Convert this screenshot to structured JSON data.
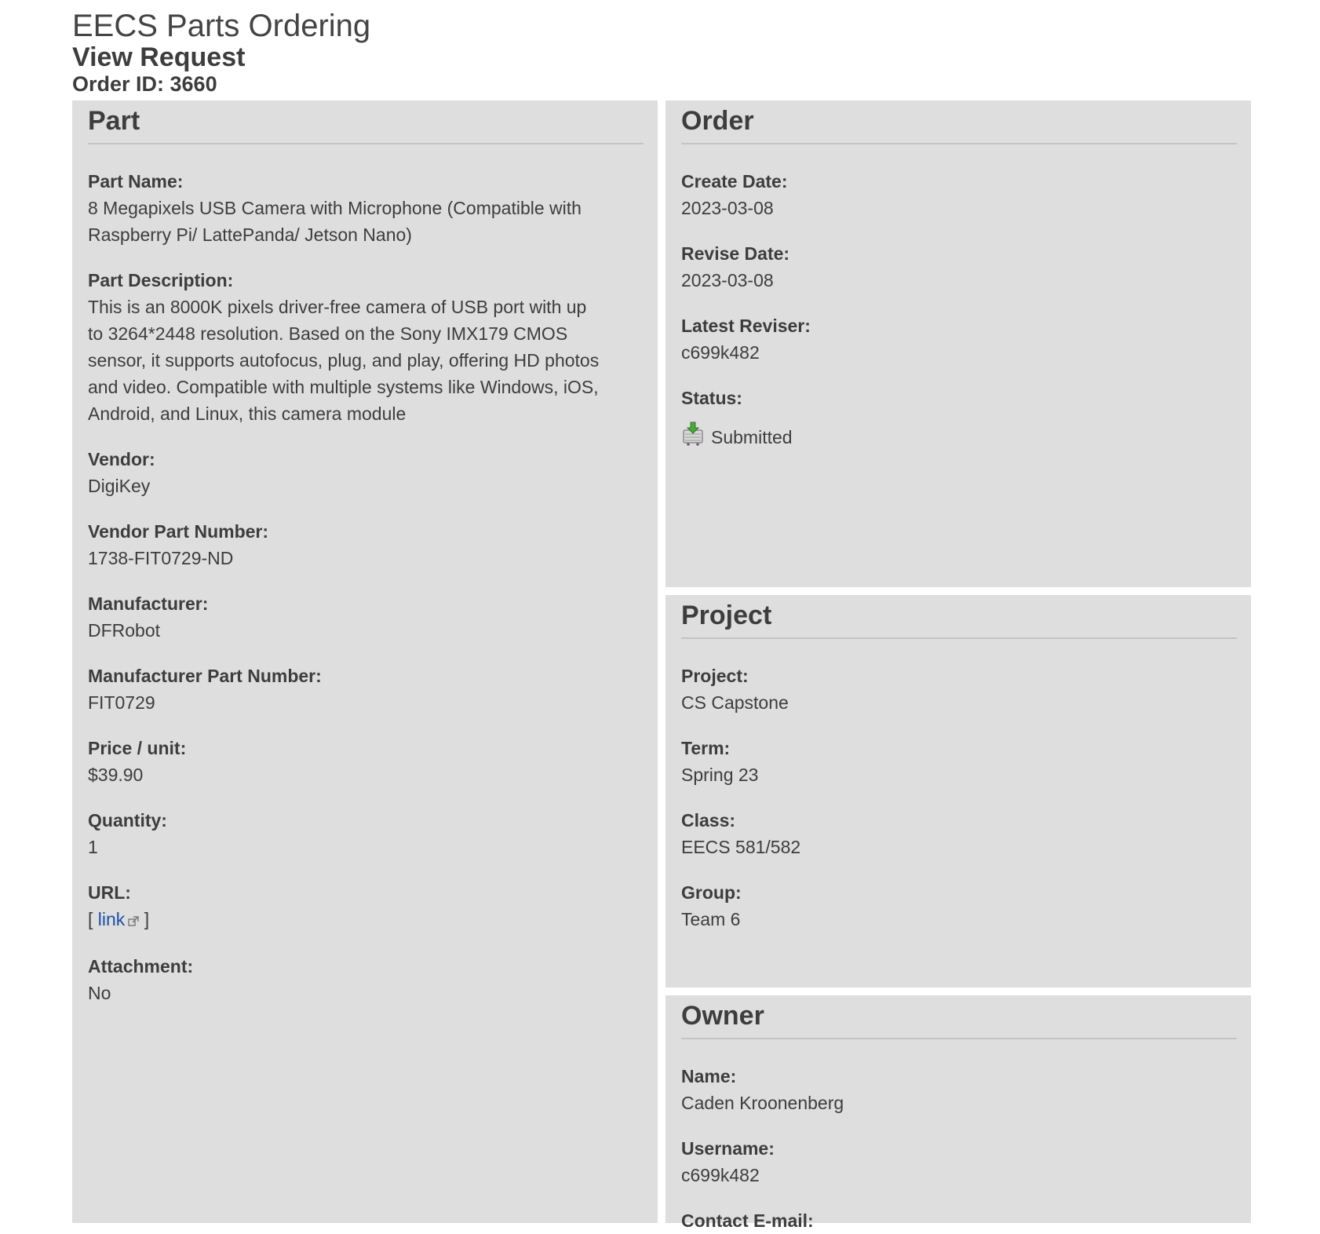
{
  "header": {
    "app_title": "EECS Parts Ordering",
    "page_title": "View Request",
    "order_id": "Order ID: 3660"
  },
  "part": {
    "heading": "Part",
    "fields": [
      {
        "label": "Part Name:",
        "value": "8 Megapixels USB Camera with Microphone (Compatible with Raspberry Pi/ LattePanda/ Jetson Nano)"
      },
      {
        "label": "Part Description:",
        "value": "This is an 8000K pixels driver-free camera of USB port with up to 3264*2448 resolution. Based on the Sony IMX179 CMOS sensor, it supports autofocus, plug, and play, offering HD photos and video. Compatible with multiple systems like Windows, iOS, Android, and Linux, this camera module"
      },
      {
        "label": "Vendor:",
        "value": "DigiKey"
      },
      {
        "label": "Vendor Part Number:",
        "value": "1738-FIT0729-ND"
      },
      {
        "label": "Manufacturer:",
        "value": "DFRobot"
      },
      {
        "label": "Manufacturer Part Number:",
        "value": "FIT0729"
      },
      {
        "label": "Price / unit:",
        "value": "$39.90"
      },
      {
        "label": "Quantity:",
        "value": "1"
      },
      {
        "label": "URL:",
        "value": ""
      },
      {
        "label": "Attachment:",
        "value": "No"
      }
    ],
    "url_open_bracket": "[",
    "url_link_text": "link",
    "url_close_bracket": "]"
  },
  "order": {
    "heading": "Order",
    "fields": [
      {
        "label": "Create Date:",
        "value": "2023-03-08"
      },
      {
        "label": "Revise Date:",
        "value": "2023-03-08"
      },
      {
        "label": "Latest Reviser:",
        "value": "c699k482"
      },
      {
        "label": "Status:",
        "value": "Submitted"
      }
    ],
    "status_icon": "cart-download-icon"
  },
  "project": {
    "heading": "Project",
    "fields": [
      {
        "label": "Project:",
        "value": "CS Capstone"
      },
      {
        "label": "Term:",
        "value": "Spring 23"
      },
      {
        "label": "Class:",
        "value": "EECS 581/582"
      },
      {
        "label": "Group:",
        "value": "Team 6"
      }
    ]
  },
  "owner": {
    "heading": "Owner",
    "fields": [
      {
        "label": "Name:",
        "value": "Caden Kroonenberg"
      },
      {
        "label": "Username:",
        "value": "c699k482"
      },
      {
        "label": "Contact E-mail:",
        "value": ""
      }
    ]
  },
  "colors": {
    "panel_bg": "#dedede",
    "text": "#3d3d3d",
    "link": "#1d4fa5"
  }
}
